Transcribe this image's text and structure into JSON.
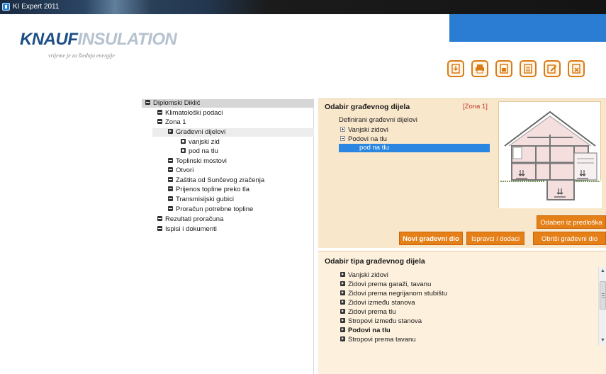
{
  "window": {
    "title": "KI Expert 2011"
  },
  "logo": {
    "brand_bold": "KNAUF",
    "brand_light": "INSULATION",
    "tagline": "vrijeme je za štednju energije"
  },
  "toolbar": {
    "buttons": [
      "import-icon",
      "print-icon",
      "save-icon",
      "document-icon",
      "edit-icon",
      "exit-icon"
    ]
  },
  "tree": {
    "root": "Diplomski Diklić",
    "items": [
      {
        "label": "Klimatološki podaci",
        "icon": "minus"
      },
      {
        "label": "Zona 1",
        "icon": "minus"
      },
      {
        "label": "Građevni dijelovi",
        "icon": "play"
      },
      {
        "label": "vanjski zid",
        "icon": "square"
      },
      {
        "label": "pod na tlu",
        "icon": "square"
      },
      {
        "label": "Toplinski mostovi",
        "icon": "minus"
      },
      {
        "label": "Otvori",
        "icon": "minus"
      },
      {
        "label": "Zaštita od Sunčevog zračenja",
        "icon": "minus"
      },
      {
        "label": "Prijenos topline preko tla",
        "icon": "minus"
      },
      {
        "label": "Transmisijski gubici",
        "icon": "minus"
      },
      {
        "label": "Proračun potrebne topline",
        "icon": "minus"
      },
      {
        "label": "Rezultati proračuna",
        "icon": "minus"
      },
      {
        "label": "Ispisi i dokumenti",
        "icon": "minus"
      }
    ]
  },
  "upper": {
    "title": "Odabir građevnog dijela",
    "zone": "[Zona 1]",
    "defined_label": "Definirani građevni dijelovi",
    "groups": [
      {
        "label": "Vanjski zidovi",
        "expanded": false
      },
      {
        "label": "Podovi na tlu",
        "expanded": true
      }
    ],
    "selected_child": "pod na tlu",
    "buttons": {
      "from_template": "Odaberi iz predloška",
      "new_part": "Novi građevni dio",
      "corrections": "Ispravci i dodaci",
      "delete_part": "Obriši građevni dio"
    }
  },
  "lower": {
    "title": "Odabir tipa građevnog dijela",
    "items": [
      {
        "label": "Vanjski zidovi",
        "bold": false
      },
      {
        "label": "Zidovi prema garaži, tavanu",
        "bold": false
      },
      {
        "label": "Zidovi prema negrijanom stubištu",
        "bold": false
      },
      {
        "label": "Zidovi između stanova",
        "bold": false
      },
      {
        "label": "Zidovi prema tlu",
        "bold": false
      },
      {
        "label": "Stropovi između stanova",
        "bold": false
      },
      {
        "label": "Podovi na tlu",
        "bold": true
      },
      {
        "label": "Stropovi prema tavanu",
        "bold": false
      }
    ]
  },
  "colors": {
    "accent": "#e57f17",
    "brand_blue": "#2a7dd3",
    "selection": "#2a86e0",
    "zone_red": "#c0392b"
  }
}
